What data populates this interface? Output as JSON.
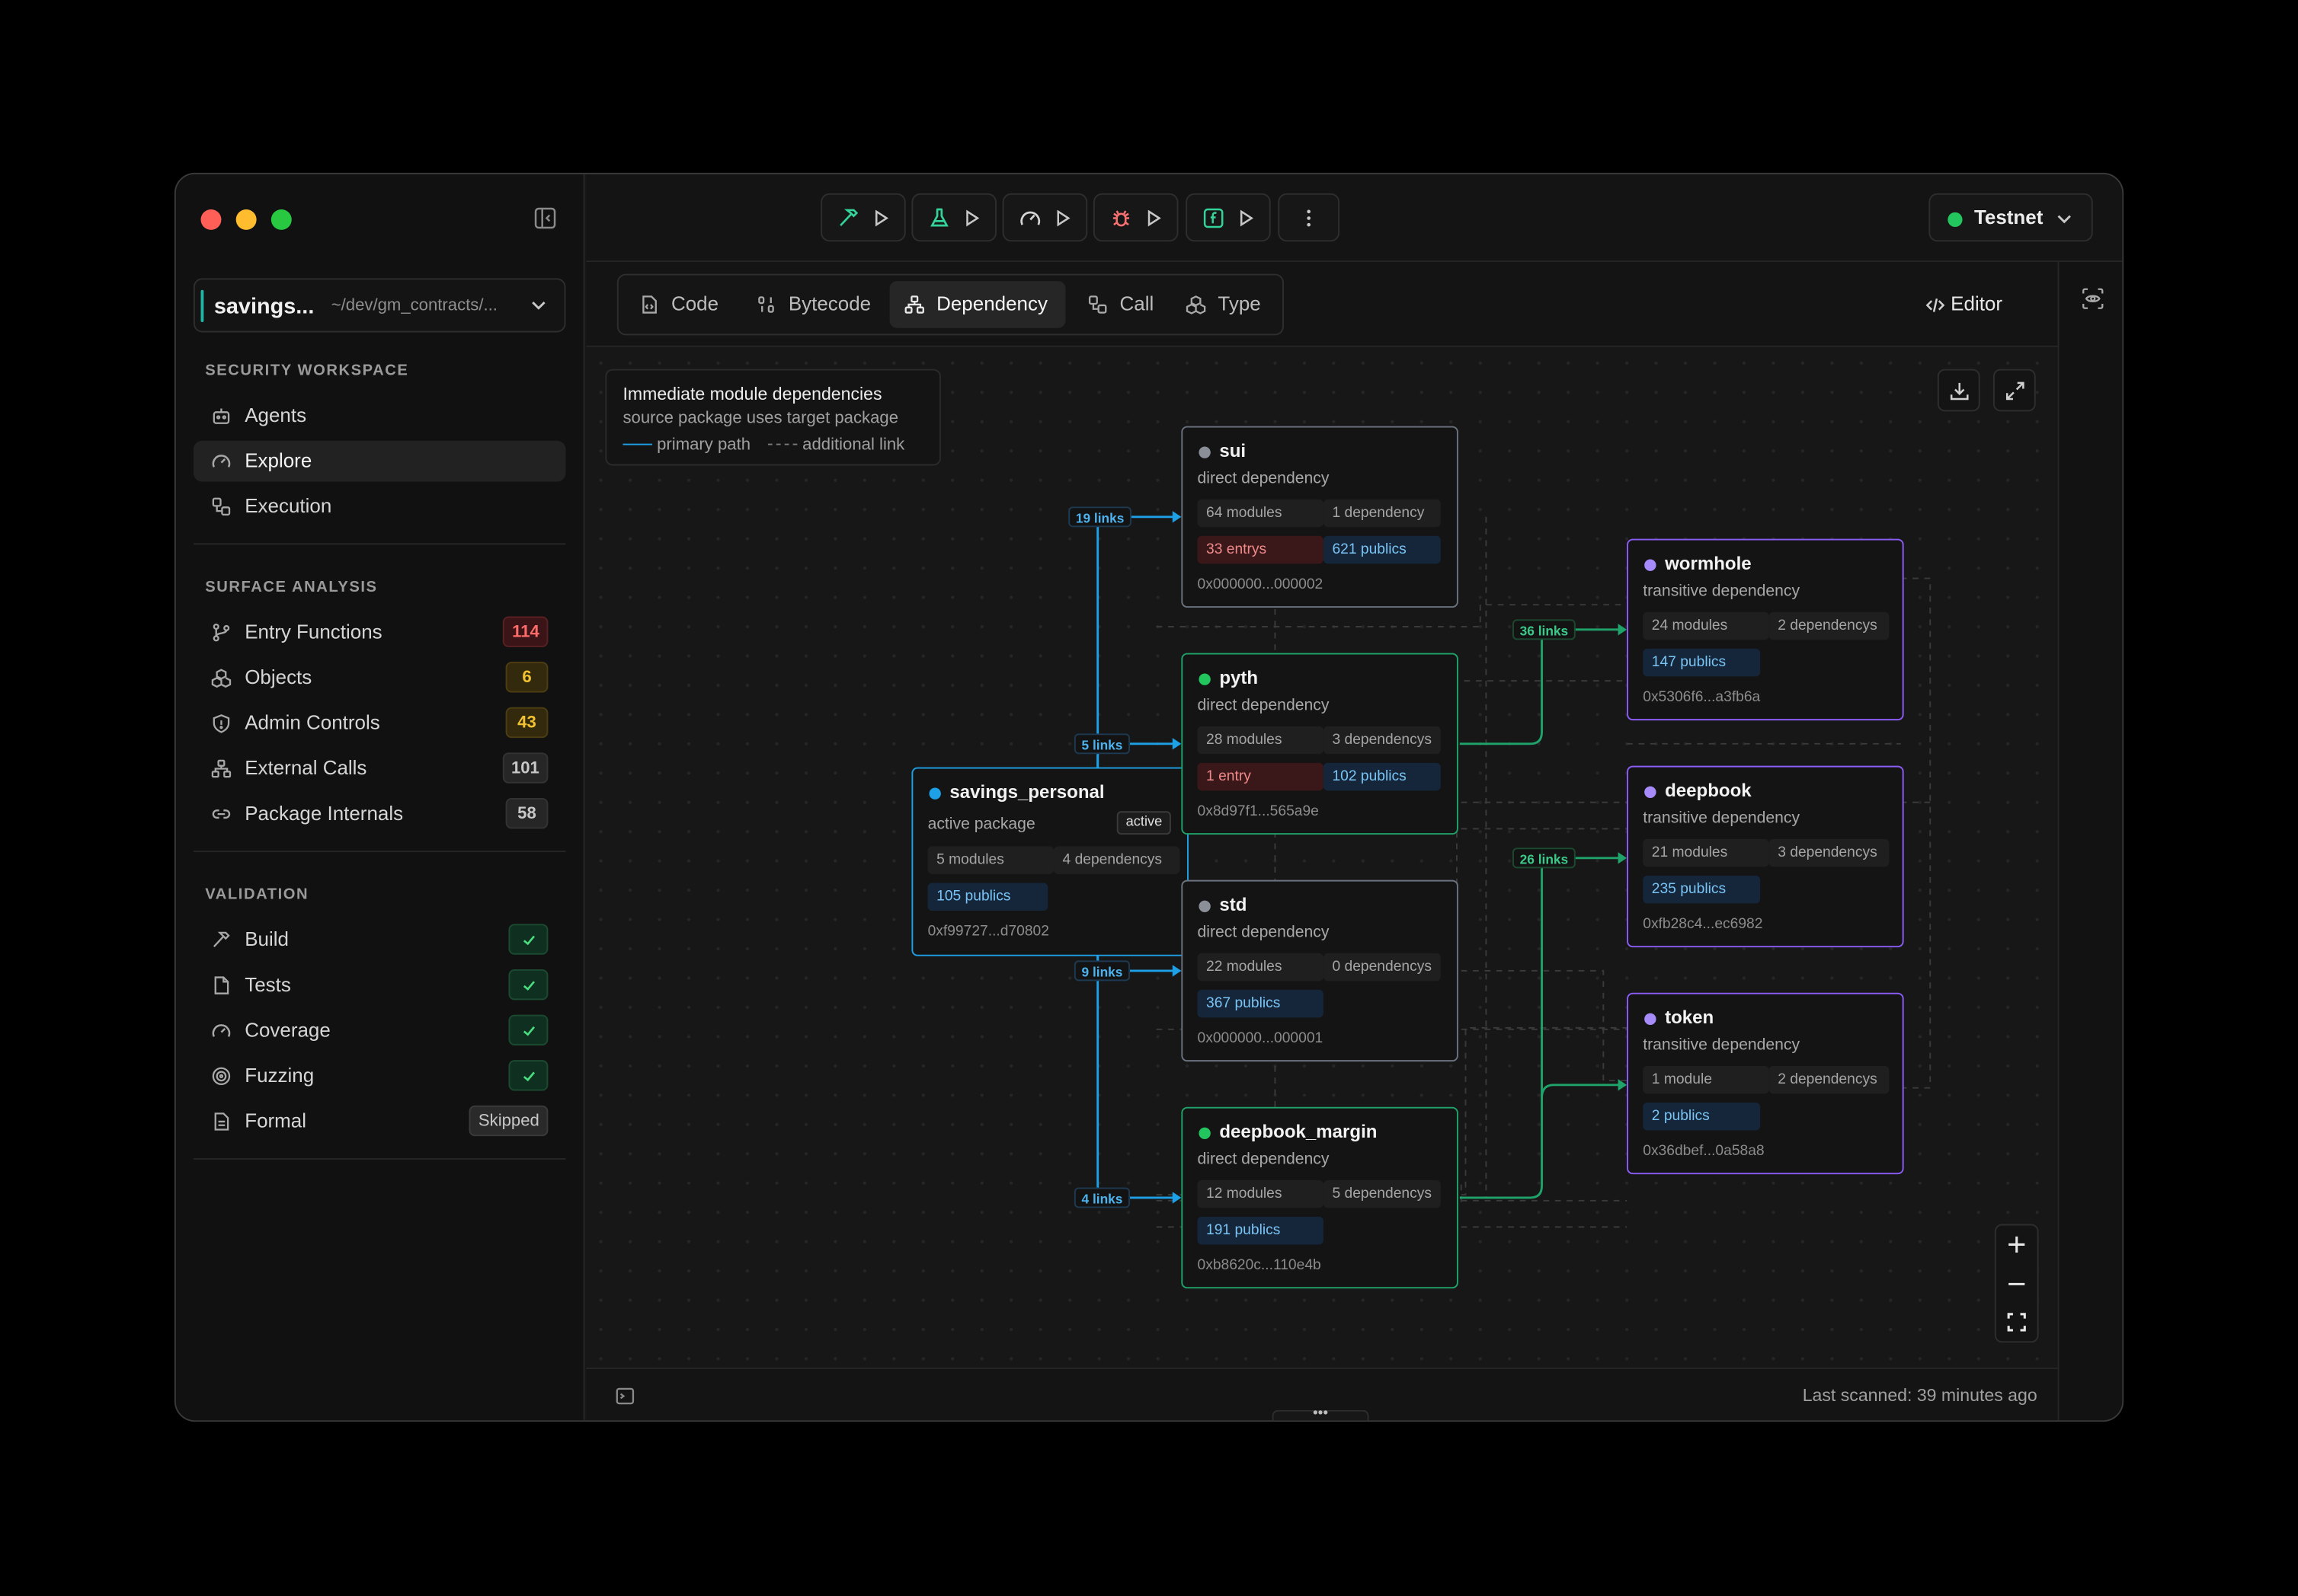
{
  "project": {
    "name": "savings...",
    "path": "~/dev/gm_contracts/..."
  },
  "sidebar": {
    "workspace_title": "SECURITY WORKSPACE",
    "workspace_items": [
      {
        "label": "Agents"
      },
      {
        "label": "Explore",
        "active": true
      },
      {
        "label": "Execution"
      }
    ],
    "surface_title": "SURFACE ANALYSIS",
    "surface_items": [
      {
        "label": "Entry Functions",
        "count": "114"
      },
      {
        "label": "Objects",
        "count": "6"
      },
      {
        "label": "Admin Controls",
        "count": "43"
      },
      {
        "label": "External Calls",
        "count": "101"
      },
      {
        "label": "Package Internals",
        "count": "58"
      }
    ],
    "validation_title": "VALIDATION",
    "validation_items": [
      {
        "label": "Build",
        "status": "passed"
      },
      {
        "label": "Tests",
        "status": "passed"
      },
      {
        "label": "Coverage",
        "status": "passed"
      },
      {
        "label": "Fuzzing",
        "status": "passed"
      },
      {
        "label": "Formal",
        "status": "Skipped"
      }
    ]
  },
  "toolbar": {
    "actions": [
      {
        "icon": "hammer-icon",
        "color": "#34d399"
      },
      {
        "icon": "flask-icon",
        "color": "#34d399"
      },
      {
        "icon": "gauge-icon",
        "color": "#d4d4d4"
      },
      {
        "icon": "bug-icon",
        "color": "#f87171"
      },
      {
        "icon": "function-icon",
        "color": "#34d399"
      }
    ],
    "network": "Testnet"
  },
  "tabs": [
    {
      "label": "Code"
    },
    {
      "label": "Bytecode"
    },
    {
      "label": "Dependency",
      "active": true
    },
    {
      "label": "Call"
    },
    {
      "label": "Type"
    }
  ],
  "editor_label": "Editor",
  "legend": {
    "title": "Immediate module dependencies",
    "subtitle": "source package uses target package",
    "primary": "primary path",
    "additional": "additional link"
  },
  "graph": {
    "root": {
      "name": "savings_personal",
      "kind": "active package",
      "tag": "active",
      "modules": "5 modules",
      "deps": "4 dependencys",
      "publics": "105 publics",
      "address": "0xf99727...d70802"
    },
    "direct": [
      {
        "name": "sui",
        "kind": "direct dependency",
        "modules": "64 modules",
        "deps": "1 dependency",
        "entries": "33 entrys",
        "publics": "621 publics",
        "address": "0x000000...000002",
        "links": "19 links",
        "dot": "#8a8f98",
        "border": "#6b7280"
      },
      {
        "name": "pyth",
        "kind": "direct dependency",
        "modules": "28 modules",
        "deps": "3 dependencys",
        "entries": "1 entry",
        "publics": "102 publics",
        "address": "0x8d97f1...565a9e",
        "links": "5 links",
        "dot": "#22c55e",
        "border": "#1fa36a"
      },
      {
        "name": "std",
        "kind": "direct dependency",
        "modules": "22 modules",
        "deps": "0 dependencys",
        "publics": "367 publics",
        "address": "0x000000...000001",
        "links": "9 links",
        "dot": "#8a8f98",
        "border": "#6b7280"
      },
      {
        "name": "deepbook_margin",
        "kind": "direct dependency",
        "modules": "12 modules",
        "deps": "5 dependencys",
        "publics": "191 publics",
        "address": "0xb8620c...110e4b",
        "links": "4 links",
        "dot": "#22c55e",
        "border": "#1fa36a"
      }
    ],
    "transitive": [
      {
        "name": "wormhole",
        "kind": "transitive dependency",
        "modules": "24 modules",
        "deps": "2 dependencys",
        "publics": "147 publics",
        "address": "0x5306f6...a3fb6a"
      },
      {
        "name": "deepbook",
        "kind": "transitive dependency",
        "modules": "21 modules",
        "deps": "3 dependencys",
        "publics": "235 publics",
        "address": "0xfb28c4...ec6982"
      },
      {
        "name": "token",
        "kind": "transitive dependency",
        "modules": "1 module",
        "deps": "2 dependencys",
        "publics": "2 publics",
        "address": "0x36dbef...0a58a8"
      }
    ],
    "green_links": [
      "36 links",
      "26 links"
    ]
  },
  "colors": {
    "primary_edge": "#1ea0e6",
    "green_edge": "#1fa36a",
    "transitive_border": "#8b5cf6",
    "root_border": "#1ea0e6"
  },
  "status": {
    "last_scanned": "Last scanned: 39 minutes ago"
  }
}
